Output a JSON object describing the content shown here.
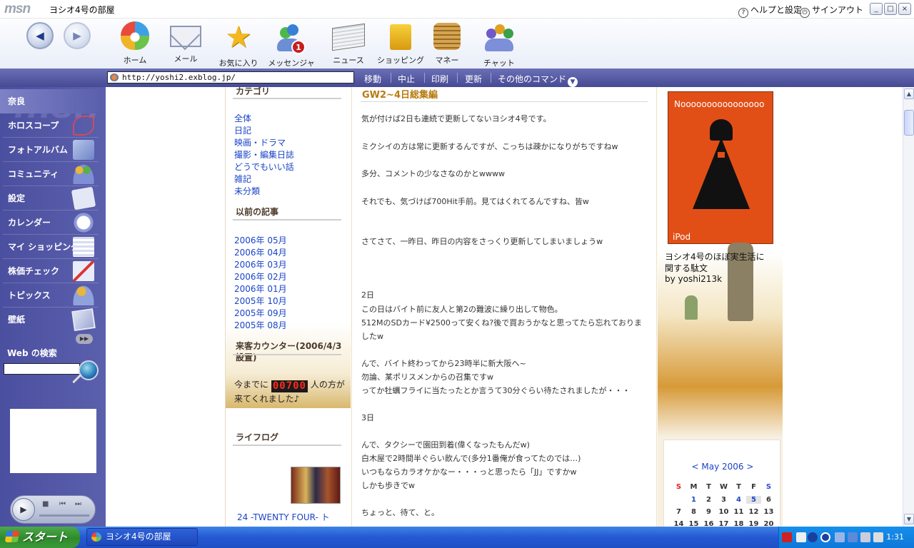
{
  "titlebar": {
    "logo": "msn",
    "title": "ヨシオ4号の部屋",
    "help": "ヘルプと設定",
    "signout": "サインアウト",
    "minimize": "_",
    "maximize": "□",
    "close": "×"
  },
  "toolbar": {
    "back": "◀",
    "forward": "▶",
    "items": [
      {
        "label": "ホーム",
        "icon": "msn-butterfly-icon"
      },
      {
        "label": "メール",
        "icon": "mail-envelope-icon"
      },
      {
        "label": "お気に入り",
        "icon": "favorites-star-icon"
      },
      {
        "label": "メッセンジャー",
        "icon": "messenger-buddies-icon",
        "badge": "1"
      },
      {
        "label": "ニュース",
        "icon": "newspaper-icon"
      },
      {
        "label": "ショッピング",
        "icon": "shopping-bag-icon"
      },
      {
        "label": "マネー",
        "icon": "coins-icon"
      },
      {
        "label": "チャット",
        "icon": "chat-people-icon"
      }
    ]
  },
  "addressbar": {
    "url": "http://yoshi2.exblog.jp/",
    "commands": [
      "移動",
      "中止",
      "印刷",
      "更新"
    ],
    "more": "その他のコマンド"
  },
  "sidebar": {
    "watermark": "msn",
    "items": [
      {
        "label": "奈良",
        "icon": ""
      },
      {
        "label": "ホロスコープ",
        "icon": "horoscope-icon"
      },
      {
        "label": "フォトアルバム",
        "icon": "photo-album-icon"
      },
      {
        "label": "コミュニティ",
        "icon": "community-people-icon"
      },
      {
        "label": "設定",
        "icon": "settings-check-icon"
      },
      {
        "label": "カレンダー",
        "icon": "calendar-clock-icon"
      },
      {
        "label": "マイ ショッピング",
        "icon": "shopping-list-icon"
      },
      {
        "label": "株価チェック",
        "icon": "stock-chart-icon"
      },
      {
        "label": "トピックス",
        "icon": "topics-people-icon"
      },
      {
        "label": "壁紙",
        "icon": "wallpaper-icon"
      }
    ],
    "expand": "▶▶",
    "web_search_label": "Web の検索",
    "web_search_value": ""
  },
  "left": {
    "category_header": "カテゴリ",
    "categories": [
      "全体",
      "日記",
      "映画・ドラマ",
      "撮影・編集日誌",
      "どうでもいい話",
      "雑記",
      "未分類"
    ],
    "archive_header": "以前の記事",
    "archives": [
      "2006年 05月",
      "2006年 04月",
      "2006年 03月",
      "2006年 02月",
      "2006年 01月",
      "2005年 10月",
      "2005年 09月",
      "2005年 08月"
    ],
    "counter_header": "来客カウンター(2006/4/3設置)",
    "counter_prefix": "今までに",
    "counter_value": "00700",
    "counter_suffix": "人の方が来てくれました♪",
    "lifelog_header": "ライフログ",
    "lifelog_item": "24 -TWENTY FOUR- ト"
  },
  "article": {
    "title": "GW2~4日総集編",
    "paragraphs": [
      "気が付けば2日も連続で更新してないヨシオ4号です。",
      "ミクシイの方は常に更新するんですが、こっちは疎かになりがちですねw",
      "多分、コメントの少なさなのかとwwww",
      "それでも、気づけば700Hit手前。見てはくれてるんですね、皆w",
      "さてさて、一昨日、昨日の内容をさっくり更新してしまいましょうw",
      "2日",
      "この日はバイト前に友人と第2の難波に繰り出して物色。",
      "512MのSDカード¥2500って安くね?後で買おうかなと思ってたら忘れておりましたw",
      "んで、バイト終わってから23時半に新大阪へ~",
      "勿論、某ポリスメンからの召集ですw",
      "ってか牡蠣フライに当たったとか言うて30分ぐらい待たされましたが・・・",
      "3日",
      "んで、タクシーで園田到着(偉くなったもんだw)",
      "白木屋で2時間半ぐらい飲んで(多分1番俺が食ってたのでは…)",
      "いつもならカラオケかなー・・・っと思ったら「JJ」ですかw",
      "しかも歩きでw",
      "ちょっと、待て、と。"
    ]
  },
  "right": {
    "ipod_header": "Noooooooooooooooo",
    "ipod_footer": "iPod",
    "description": "ヨシオ4号のほぼ実生活に関する駄文",
    "byline": "by yoshi213k",
    "calendar": {
      "prev": "<",
      "month": "May 2006",
      "next": ">",
      "weekdays": [
        "S",
        "M",
        "T",
        "W",
        "T",
        "F",
        "S"
      ],
      "weeks": [
        [
          "",
          "1",
          "2",
          "3",
          "4",
          "5",
          "6"
        ],
        [
          "7",
          "8",
          "9",
          "10",
          "11",
          "12",
          "13"
        ],
        [
          "14",
          "15",
          "16",
          "17",
          "18",
          "19",
          "20"
        ]
      ],
      "linked_days": [
        "1",
        "4",
        "5"
      ],
      "today": "5"
    }
  },
  "taskbar": {
    "start": "スタート",
    "window": "ヨシオ4号の部屋",
    "clock": "1:31"
  },
  "colors": {
    "sidebar": "#5b60ad",
    "addressbar": "#4a4f9c",
    "link": "#1a44c8",
    "title": "#b87a10",
    "counter": "#ff2a1c",
    "ipod": "#e24f16",
    "taskbar": "#245edb",
    "start": "#3c9a3a"
  }
}
